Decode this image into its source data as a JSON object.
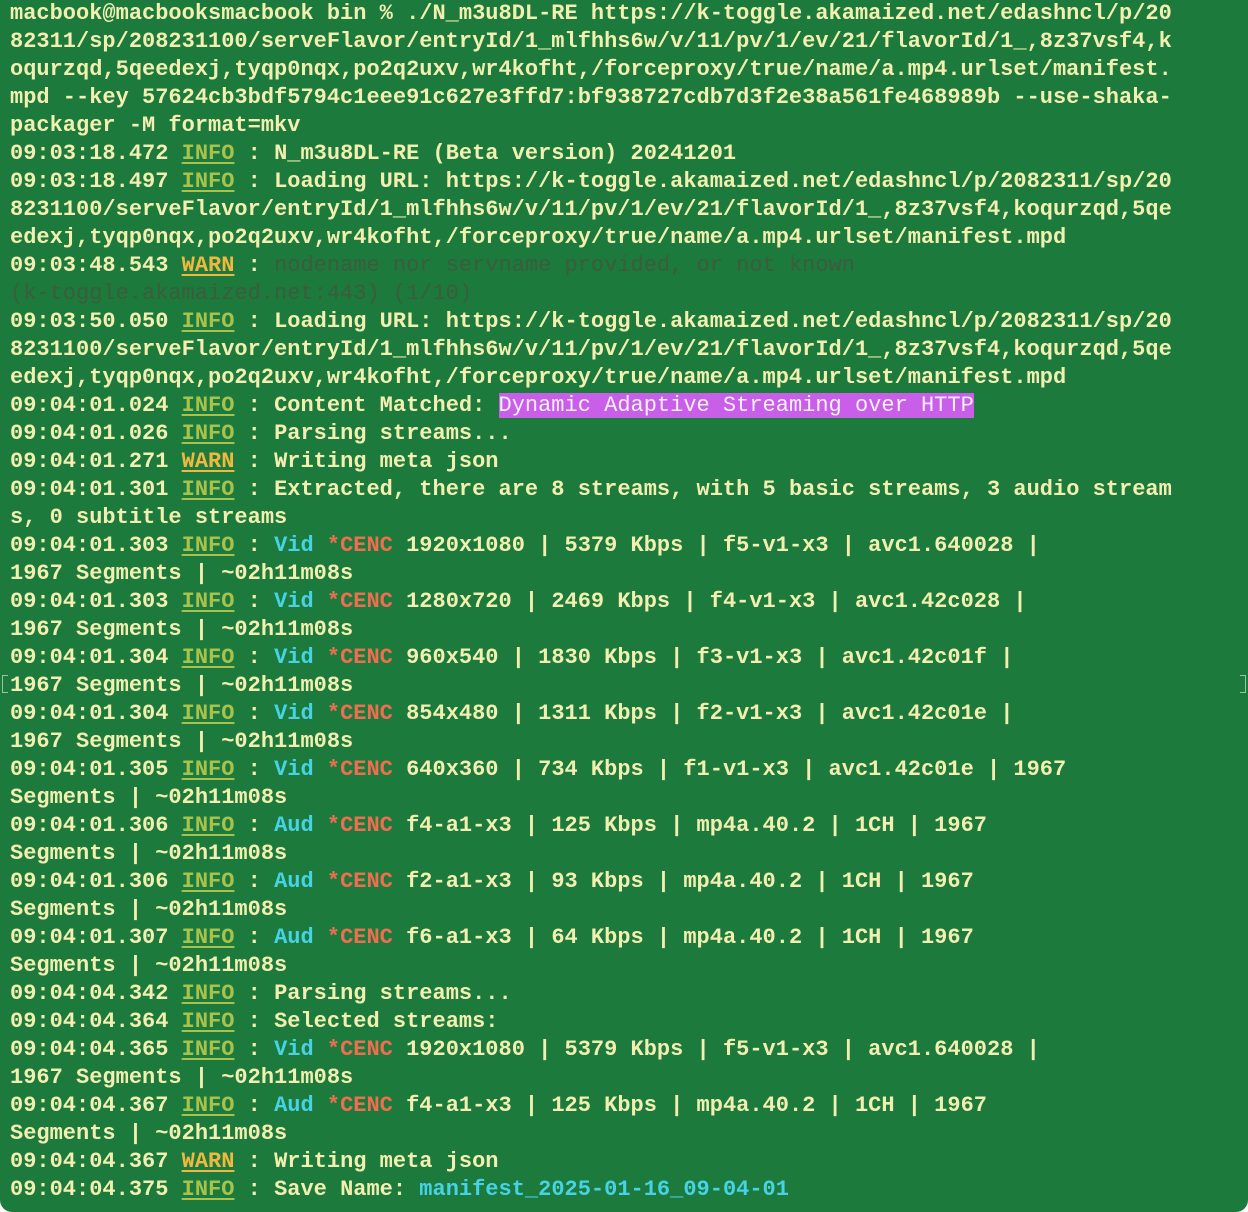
{
  "terminal": {
    "prompt": "macbook@macbooksmacbook bin % ",
    "command_lines": [
      "./N_m3u8DL-RE https://k-toggle.akamaized.net/edashncl/p/20",
      "82311/sp/208231100/serveFlavor/entryId/1_mlfhhs6w/v/11/pv/1/ev/21/flavorId/1_,8z37vsf4,k",
      "oqurzqd,5qeedexj,tyqp0nqx,po2q2uxv,wr4kofht,/forceproxy/true/name/a.mp4.urlset/manifest.",
      "mpd --key 57624cb3bdf5794c1eee91c627e3ffd7:bf938727cdb7d3f2e38a561fe468989b --use-shaka-",
      "packager -M format=mkv"
    ],
    "sep": " : ",
    "lines": [
      {
        "ts": "09:03:18.472",
        "level": "INFO",
        "parts": [
          {
            "t": "N_m3u8DL-RE (Beta version) 20241201"
          }
        ]
      },
      {
        "ts": "09:03:18.497",
        "level": "INFO",
        "parts": [
          {
            "t": "Loading URL: https://k-toggle.akamaized.net/edashncl/p/2082311/sp/20"
          }
        ]
      },
      {
        "cont": [
          {
            "t": "8231100/serveFlavor/entryId/1_mlfhhs6w/v/11/pv/1/ev/21/flavorId/1_,8z37vsf4,koqurzqd,5qe"
          }
        ]
      },
      {
        "cont": [
          {
            "t": "edexj,tyqp0nqx,po2q2uxv,wr4kofht,/forceproxy/true/name/a.mp4.urlset/manifest.mpd"
          }
        ]
      },
      {
        "ts": "09:03:48.543",
        "level": "WARN",
        "parts": [
          {
            "t": "nodename nor servname provided, or not known",
            "c": "dim"
          }
        ]
      },
      {
        "cont": [
          {
            "t": "(k-toggle.akamaized.net:443) (1/10)",
            "c": "dim"
          }
        ]
      },
      {
        "ts": "09:03:50.050",
        "level": "INFO",
        "parts": [
          {
            "t": "Loading URL: https://k-toggle.akamaized.net/edashncl/p/2082311/sp/20"
          }
        ]
      },
      {
        "cont": [
          {
            "t": "8231100/serveFlavor/entryId/1_mlfhhs6w/v/11/pv/1/ev/21/flavorId/1_,8z37vsf4,koqurzqd,5qe"
          }
        ]
      },
      {
        "cont": [
          {
            "t": "edexj,tyqp0nqx,po2q2uxv,wr4kofht,/forceproxy/true/name/a.mp4.urlset/manifest.mpd"
          }
        ]
      },
      {
        "ts": "09:04:01.024",
        "level": "INFO",
        "parts": [
          {
            "t": "Content Matched: "
          },
          {
            "t": "Dynamic Adaptive Streaming over HTTP",
            "c": "hl"
          }
        ]
      },
      {
        "ts": "09:04:01.026",
        "level": "INFO",
        "parts": [
          {
            "t": "Parsing streams..."
          }
        ]
      },
      {
        "ts": "09:04:01.271",
        "level": "WARN",
        "parts": [
          {
            "t": "Writing meta json"
          }
        ]
      },
      {
        "ts": "09:04:01.301",
        "level": "INFO",
        "parts": [
          {
            "t": "Extracted, there are 8 streams, with 5 basic streams, 3 audio stream"
          }
        ]
      },
      {
        "cont": [
          {
            "t": "s, 0 subtitle streams"
          }
        ]
      },
      {
        "ts": "09:04:01.303",
        "level": "INFO",
        "parts": [
          {
            "t": "Vid",
            "c": "vid"
          },
          {
            "t": " "
          },
          {
            "t": "*CENC",
            "c": "cenc"
          },
          {
            "t": " 1920x1080 | 5379 Kbps | f5-v1-x3 | avc1.640028 |"
          }
        ]
      },
      {
        "cont": [
          {
            "t": "1967 Segments | ~02h11m08s"
          }
        ]
      },
      {
        "ts": "09:04:01.303",
        "level": "INFO",
        "parts": [
          {
            "t": "Vid",
            "c": "vid"
          },
          {
            "t": " "
          },
          {
            "t": "*CENC",
            "c": "cenc"
          },
          {
            "t": " 1280x720 | 2469 Kbps | f4-v1-x3 | avc1.42c028 |"
          }
        ]
      },
      {
        "cont": [
          {
            "t": "1967 Segments | ~02h11m08s"
          }
        ]
      },
      {
        "ts": "09:04:01.304",
        "level": "INFO",
        "parts": [
          {
            "t": "Vid",
            "c": "vid"
          },
          {
            "t": " "
          },
          {
            "t": "*CENC",
            "c": "cenc"
          },
          {
            "t": " 960x540 | 1830 Kbps | f3-v1-x3 | avc1.42c01f |"
          }
        ]
      },
      {
        "cont": [
          {
            "t": "1967 Segments | ~02h11m08s"
          }
        ]
      },
      {
        "ts": "09:04:01.304",
        "level": "INFO",
        "parts": [
          {
            "t": "Vid",
            "c": "vid"
          },
          {
            "t": " "
          },
          {
            "t": "*CENC",
            "c": "cenc"
          },
          {
            "t": " 854x480 | 1311 Kbps | f2-v1-x3 | avc1.42c01e |"
          }
        ]
      },
      {
        "cont": [
          {
            "t": "1967 Segments | ~02h11m08s"
          }
        ]
      },
      {
        "ts": "09:04:01.305",
        "level": "INFO",
        "parts": [
          {
            "t": "Vid",
            "c": "vid"
          },
          {
            "t": " "
          },
          {
            "t": "*CENC",
            "c": "cenc"
          },
          {
            "t": " 640x360 | 734 Kbps | f1-v1-x3 | avc1.42c01e | 1967"
          }
        ]
      },
      {
        "cont": [
          {
            "t": "Segments | ~02h11m08s"
          }
        ]
      },
      {
        "ts": "09:04:01.306",
        "level": "INFO",
        "parts": [
          {
            "t": "Aud",
            "c": "aud"
          },
          {
            "t": " "
          },
          {
            "t": "*CENC",
            "c": "cenc"
          },
          {
            "t": " f4-a1-x3 | 125 Kbps | mp4a.40.2 | 1CH | 1967"
          }
        ]
      },
      {
        "cont": [
          {
            "t": "Segments | ~02h11m08s"
          }
        ]
      },
      {
        "ts": "09:04:01.306",
        "level": "INFO",
        "parts": [
          {
            "t": "Aud",
            "c": "aud"
          },
          {
            "t": " "
          },
          {
            "t": "*CENC",
            "c": "cenc"
          },
          {
            "t": " f2-a1-x3 | 93 Kbps | mp4a.40.2 | 1CH | 1967"
          }
        ]
      },
      {
        "cont": [
          {
            "t": "Segments | ~02h11m08s"
          }
        ]
      },
      {
        "ts": "09:04:01.307",
        "level": "INFO",
        "parts": [
          {
            "t": "Aud",
            "c": "aud"
          },
          {
            "t": " "
          },
          {
            "t": "*CENC",
            "c": "cenc"
          },
          {
            "t": " f6-a1-x3 | 64 Kbps | mp4a.40.2 | 1CH | 1967"
          }
        ]
      },
      {
        "cont": [
          {
            "t": "Segments | ~02h11m08s"
          }
        ]
      },
      {
        "ts": "09:04:04.342",
        "level": "INFO",
        "parts": [
          {
            "t": "Parsing streams..."
          }
        ]
      },
      {
        "ts": "09:04:04.364",
        "level": "INFO",
        "parts": [
          {
            "t": "Selected streams:"
          }
        ]
      },
      {
        "ts": "09:04:04.365",
        "level": "INFO",
        "parts": [
          {
            "t": "Vid",
            "c": "vid"
          },
          {
            "t": " "
          },
          {
            "t": "*CENC",
            "c": "cenc"
          },
          {
            "t": " 1920x1080 | 5379 Kbps | f5-v1-x3 | avc1.640028 |"
          }
        ]
      },
      {
        "cont": [
          {
            "t": "1967 Segments | ~02h11m08s"
          }
        ]
      },
      {
        "ts": "09:04:04.367",
        "level": "INFO",
        "parts": [
          {
            "t": "Aud",
            "c": "aud"
          },
          {
            "t": " "
          },
          {
            "t": "*CENC",
            "c": "cenc"
          },
          {
            "t": " f4-a1-x3 | 125 Kbps | mp4a.40.2 | 1CH | 1967"
          }
        ]
      },
      {
        "cont": [
          {
            "t": "Segments | ~02h11m08s"
          }
        ]
      },
      {
        "ts": "09:04:04.367",
        "level": "WARN",
        "parts": [
          {
            "t": "Writing meta json"
          }
        ]
      },
      {
        "ts": "09:04:04.375",
        "level": "INFO",
        "parts": [
          {
            "t": "Save Name: "
          },
          {
            "t": "manifest_2025-01-16_09-04-01",
            "c": "cyan"
          }
        ]
      }
    ]
  },
  "colors": {
    "background": "#1b7a3c",
    "text": "#f3efb0",
    "info": "#a9c24b",
    "warn": "#f0b840",
    "stream_type": "#48d2e6",
    "cenc": "#ee6e4f",
    "highlight": "#c95ee8"
  }
}
